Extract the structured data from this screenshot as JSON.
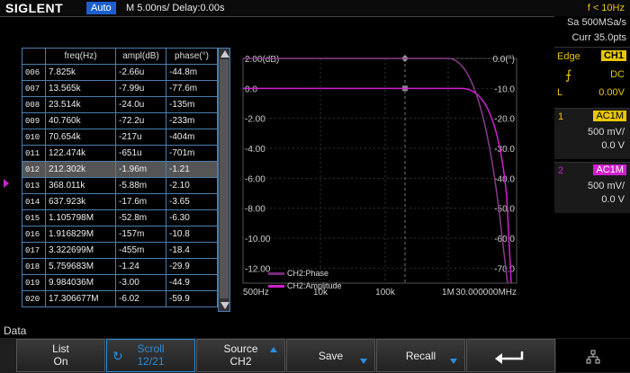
{
  "header": {
    "brand": "SIGLENT",
    "mode": "Auto",
    "timebase": "M 5.00ns/  Delay:0.00s",
    "trigger_freq": "f < 10Hz"
  },
  "acquisition": {
    "sample_rate": "Sa 500MSa/s",
    "curr_points": "Curr 35.0pts"
  },
  "trigger": {
    "type": "Edge",
    "source": "CH1",
    "slope_icon": "rising-edge-icon",
    "coupling": "DC",
    "level_label": "L",
    "level": "0.00V"
  },
  "channels": [
    {
      "num": "1",
      "coupling": "AC1M",
      "scale": "500 mV/",
      "offset": "0.0 V",
      "color": "#e8c800"
    },
    {
      "num": "2",
      "coupling": "AC1M",
      "scale": "500 mV/",
      "offset": "0.0 V",
      "color": "#d020d0"
    }
  ],
  "table": {
    "headers": [
      "",
      "freq(Hz)",
      "ampl(dB)",
      "phase(°)"
    ],
    "selected_index": 6,
    "rows": [
      [
        "006",
        "7.825k",
        "-2.66u",
        "-44.8m"
      ],
      [
        "007",
        "13.565k",
        "-7.99u",
        "-77.6m"
      ],
      [
        "008",
        "23.514k",
        "-24.0u",
        "-135m"
      ],
      [
        "009",
        "40.760k",
        "-72.2u",
        "-233m"
      ],
      [
        "010",
        "70.654k",
        "-217u",
        "-404m"
      ],
      [
        "011",
        "122.474k",
        "-651u",
        "-701m"
      ],
      [
        "012",
        "212.302k",
        "-1.96m",
        "-1.21"
      ],
      [
        "013",
        "368.011k",
        "-5.88m",
        "-2.10"
      ],
      [
        "014",
        "637.923k",
        "-17.6m",
        "-3.65"
      ],
      [
        "015",
        "1.105798M",
        "-52.8m",
        "-6.30"
      ],
      [
        "016",
        "1.916829M",
        "-157m",
        "-10.8"
      ],
      [
        "017",
        "3.322699M",
        "-455m",
        "-18.4"
      ],
      [
        "018",
        "5.759683M",
        "-1.24",
        "-29.9"
      ],
      [
        "019",
        "9.984036M",
        "-3.00",
        "-44.9"
      ],
      [
        "020",
        "17.306677M",
        "-6.02",
        "-59.9"
      ]
    ]
  },
  "plot": {
    "left_labels": [
      "2.00(dB)",
      "0.0",
      "-2.00",
      "-4.00",
      "-6.00",
      "-8.00",
      "-10.00",
      "-12.00"
    ],
    "right_labels": [
      "0.0(°)",
      "-10.0",
      "-20.0",
      "-30.0",
      "-40.0",
      "-50.0",
      "-60.0",
      "-70.0"
    ],
    "x_labels": [
      "500Hz",
      "10k",
      "100k",
      "1M",
      "30.000000MHz"
    ],
    "legend": [
      {
        "name": "CH2:Phase",
        "color": "#7a2a7a"
      },
      {
        "name": "CH2:Amplitude",
        "color": "#d020d0"
      }
    ],
    "amplitude_color": "#d020d0",
    "phase_color": "#8a3a8a",
    "grid_color": "#333333"
  },
  "menu": {
    "title": "Data",
    "softkeys": {
      "list": [
        "List",
        "On"
      ],
      "scroll": [
        "Scroll",
        "12/21"
      ],
      "source": [
        "Source",
        "CH2"
      ],
      "save": "Save",
      "recall": "Recall"
    }
  },
  "icons": {
    "scroll_knob": "knob-icon",
    "back": "return-arrow-icon",
    "network": "network-icon"
  }
}
